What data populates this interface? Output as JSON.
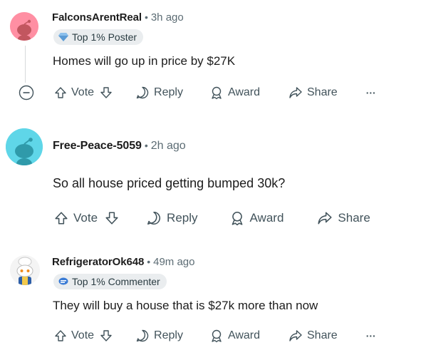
{
  "comments": [
    {
      "username": "FalconsArentReal",
      "time": "3h ago",
      "flair": "Top 1% Poster",
      "text": "Homes will go up in price by $27K",
      "vote_label": "Vote",
      "reply_label": "Reply",
      "award_label": "Award",
      "share_label": "Share",
      "more_label": "···",
      "avatar_color": "#ff8fa3"
    },
    {
      "username": "Free-Peace-5059",
      "time": "2h ago",
      "text": "So all house priced getting bumped 30k?",
      "vote_label": "Vote",
      "reply_label": "Reply",
      "award_label": "Award",
      "share_label": "Share",
      "avatar_color": "#5fd6e8"
    },
    {
      "username": "RefrigeratorOk648",
      "time": "49m ago",
      "flair": "Top 1% Commenter",
      "text": "They will buy a house that is $27k more than now",
      "vote_label": "Vote",
      "reply_label": "Reply",
      "award_label": "Award",
      "share_label": "Share",
      "more_label": "···",
      "avatar_color": "#f4f4f4"
    }
  ],
  "separator": "•"
}
